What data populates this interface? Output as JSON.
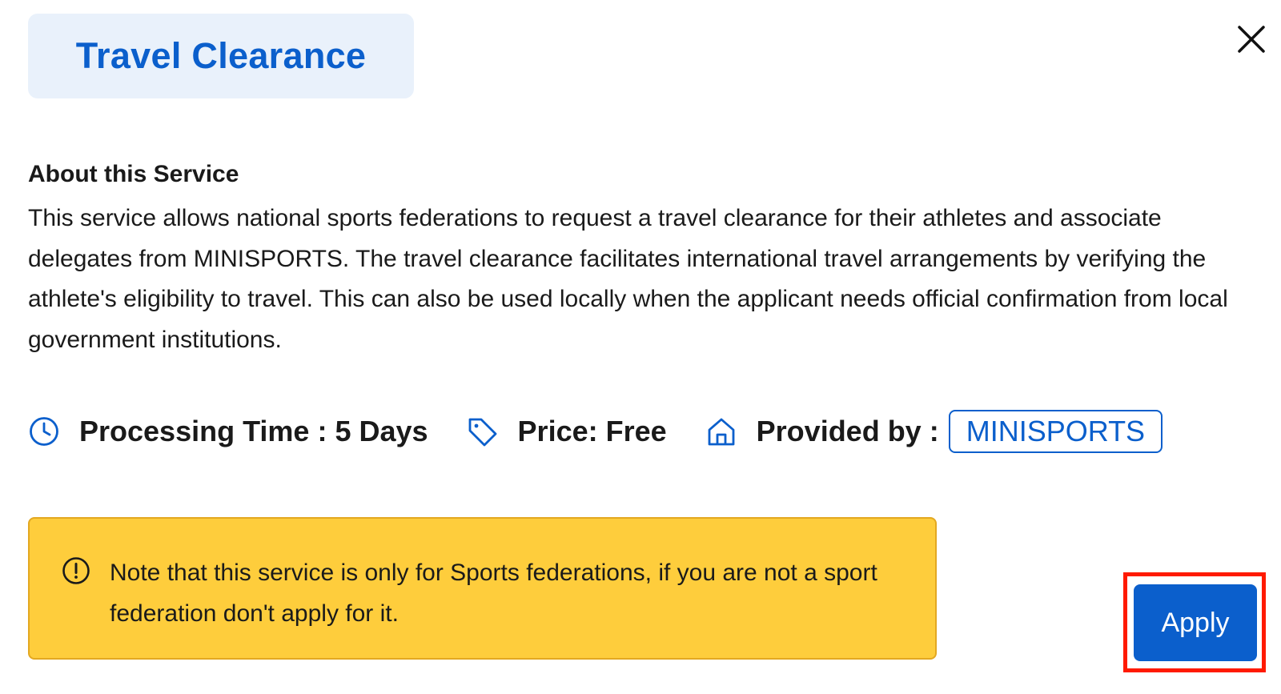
{
  "header": {
    "title": "Travel Clearance",
    "close_icon": "close-icon"
  },
  "about": {
    "heading": "About this Service",
    "body": "This service allows national sports federations to request a travel clearance for their athletes and associate delegates from MINISPORTS. The travel clearance facilitates international travel arrangements by verifying the athlete's eligibility to travel. This can also be used locally when the applicant needs official confirmation from local government institutions."
  },
  "meta": {
    "processing_time": {
      "icon": "clock-icon",
      "label": "Processing Time : 5 Days"
    },
    "price": {
      "icon": "tag-icon",
      "label": "Price: Free"
    },
    "provider": {
      "icon": "home-icon",
      "label": "Provided by :",
      "value": "MINISPORTS"
    }
  },
  "notice": {
    "icon": "alert-circle-icon",
    "text": "Note that this service is only for Sports federations, if you are not a sport federation don't apply for it."
  },
  "actions": {
    "apply_label": "Apply"
  },
  "colors": {
    "accent": "#0b5fcc",
    "title_chip_bg": "#e9f1fb",
    "notice_bg": "#fecd3c",
    "notice_border": "#e3a821",
    "highlight": "#ff1a00"
  }
}
